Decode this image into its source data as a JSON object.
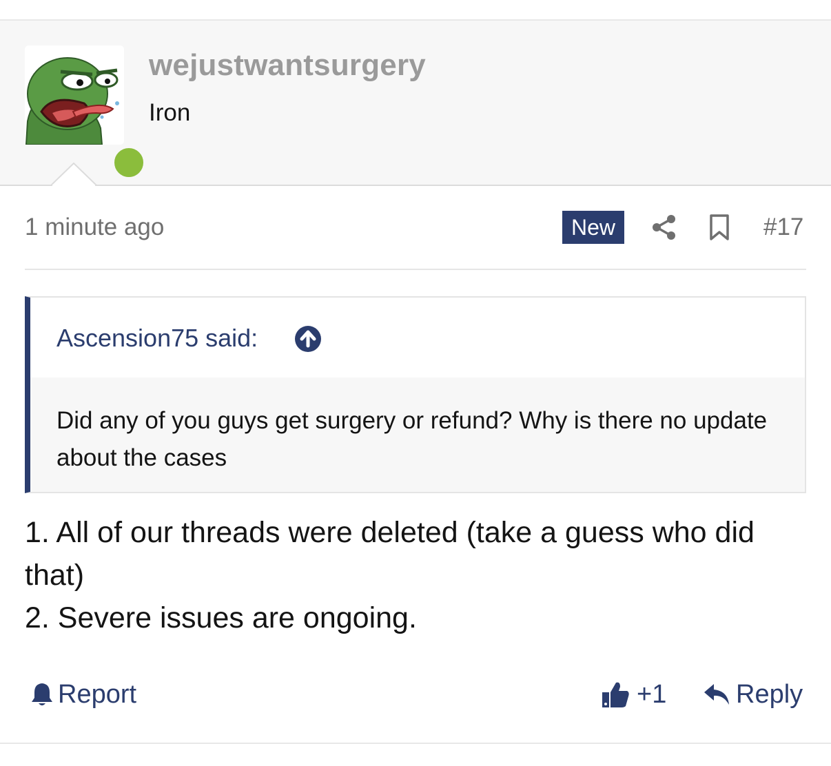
{
  "user": {
    "name": "wejustwantsurgery",
    "title": "Iron",
    "avatar_icon": "angry-frog-avatar",
    "online_status_color": "#8bbd3c"
  },
  "post": {
    "timestamp": "1 minute ago",
    "badge": "New",
    "number": "#17",
    "quote": {
      "attribution": "Ascension75 said:",
      "text": "Did any of you guys get surgery or refund? Why is there no update about the cases"
    },
    "body_lines": [
      "1. All of our threads were deleted (take a guess who did that)",
      "2. Severe issues are ongoing."
    ]
  },
  "actions": {
    "report_label": "Report",
    "like_count": "+1",
    "reply_label": "Reply"
  },
  "colors": {
    "accent": "#2b3d6e",
    "muted_text": "#6f6f6f",
    "header_bg": "#f7f7f7"
  }
}
